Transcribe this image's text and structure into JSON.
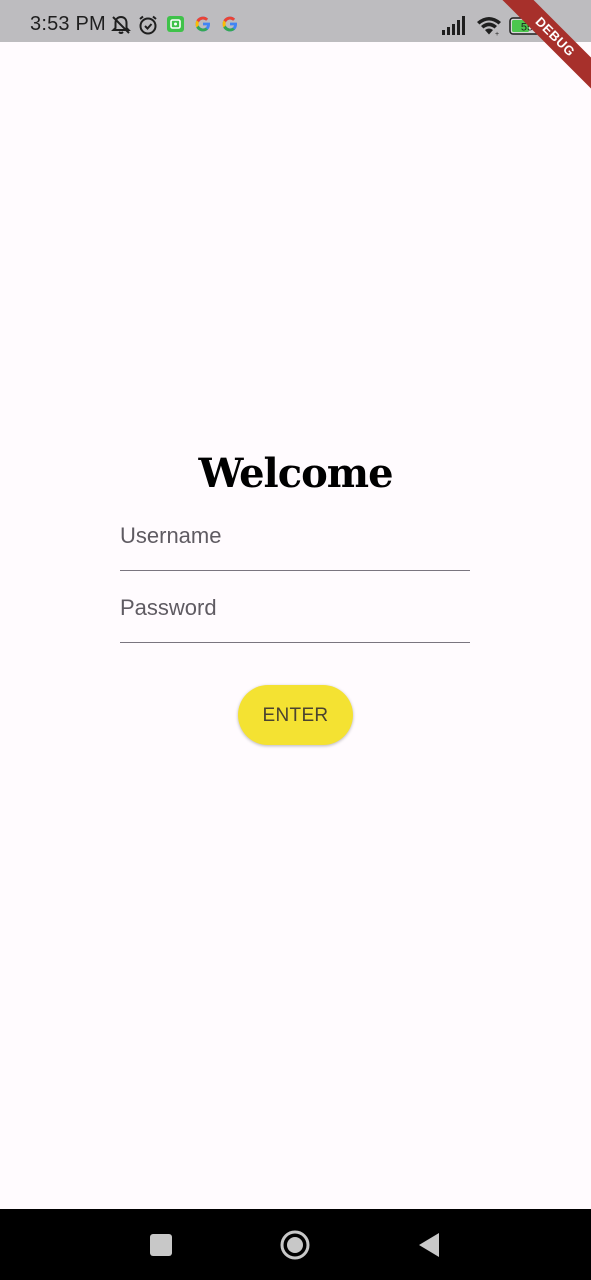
{
  "status_bar": {
    "time": "3:53 PM",
    "battery_level": "55",
    "debug_label": "DEBUG",
    "icons": [
      "mute-icon",
      "alarm-icon",
      "square-app-icon",
      "google-icon",
      "google-icon",
      "signal-icon",
      "wifi-icon",
      "battery-icon"
    ]
  },
  "login": {
    "title": "Welcome",
    "username_label": "Username",
    "password_label": "Password",
    "enter_label": "ENTER"
  },
  "colors": {
    "background": "#fffbfe",
    "status_bar": "#bdbcbf",
    "button_yellow": "#f4e232",
    "debug_red": "#a7302b",
    "nav_bar": "#000000"
  },
  "nav_bar": {
    "buttons": [
      "recents-icon",
      "home-icon",
      "back-icon"
    ]
  }
}
